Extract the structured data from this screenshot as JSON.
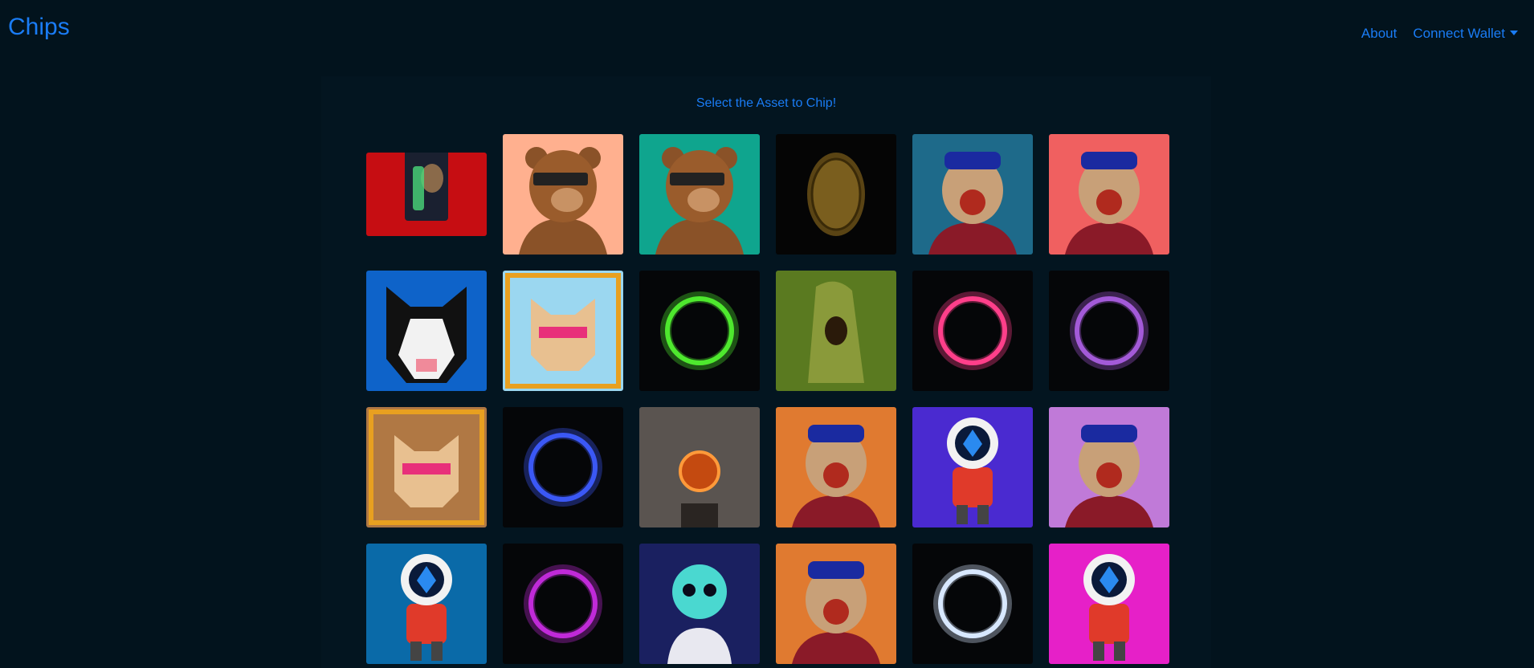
{
  "navbar": {
    "brand": "Chips",
    "about": "About",
    "wallet": "Connect Wallet"
  },
  "main": {
    "prompt": "Select the Asset to Chip!"
  },
  "assets": [
    {
      "name": "toy-ape-package",
      "bg": "#c60d12",
      "kind": "package"
    },
    {
      "name": "bear-3d-glasses",
      "bg": "#ffb08f",
      "kind": "bear"
    },
    {
      "name": "bear-purple-shades",
      "bg": "#0fa58e",
      "kind": "bear"
    },
    {
      "name": "gold-coin",
      "bg": "#050505",
      "kind": "coin"
    },
    {
      "name": "psychedelic-ape-mask",
      "bg": "#1e6a8a",
      "kind": "ape"
    },
    {
      "name": "ape-bucket-hat",
      "bg": "#f06060",
      "kind": "ape"
    },
    {
      "name": "pixel-husky",
      "bg": "#0e63c9",
      "kind": "husky"
    },
    {
      "name": "pixel-shiba-framed",
      "bg": "#9bd7f0",
      "kind": "shiba"
    },
    {
      "name": "ring-green",
      "bg": "#050608",
      "kind": "ring",
      "color": "#4ee82e"
    },
    {
      "name": "pickle-monster",
      "bg": "#5a7a20",
      "kind": "pickle"
    },
    {
      "name": "ring-pink",
      "bg": "#050608",
      "kind": "ring",
      "color": "#ff3f8a"
    },
    {
      "name": "ring-purple-blue",
      "bg": "#050608",
      "kind": "ring",
      "color": "#a35ad8"
    },
    {
      "name": "pixel-shiba-word-grid",
      "bg": "#b07844",
      "kind": "shiba"
    },
    {
      "name": "ring-blue",
      "bg": "#050608",
      "kind": "ring",
      "color": "#3b58f5"
    },
    {
      "name": "orange-medallion",
      "bg": "#5a5450",
      "kind": "medallion"
    },
    {
      "name": "ape-gas-mask-pumpkins",
      "bg": "#e07a30",
      "kind": "ape"
    },
    {
      "name": "astronaut-purple",
      "bg": "#4a2ad0",
      "kind": "astronaut"
    },
    {
      "name": "ape-space-helmet",
      "bg": "#c07ad8",
      "kind": "ape"
    },
    {
      "name": "astronaut-blue",
      "bg": "#0a6aa8",
      "kind": "astronaut"
    },
    {
      "name": "ring-magenta",
      "bg": "#050608",
      "kind": "ring",
      "color": "#c02ad8"
    },
    {
      "name": "skull-astronaut",
      "bg": "#1a2060",
      "kind": "skull"
    },
    {
      "name": "ape-cap-pumpkins",
      "bg": "#e07a30",
      "kind": "ape"
    },
    {
      "name": "ring-white-rainbow",
      "bg": "#050608",
      "kind": "ring",
      "color": "#d8e8ff"
    },
    {
      "name": "astronaut-magenta",
      "bg": "#e620c8",
      "kind": "astronaut"
    }
  ]
}
